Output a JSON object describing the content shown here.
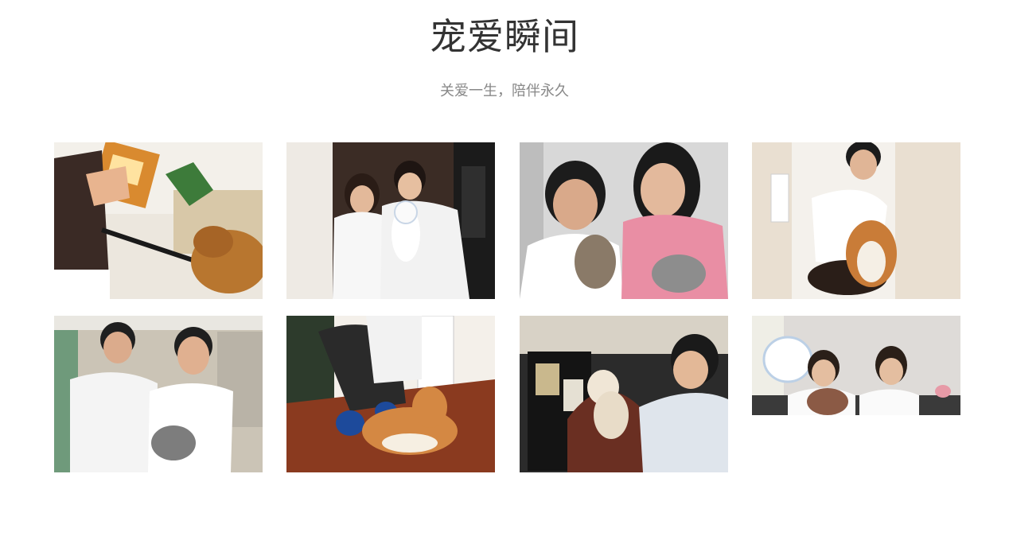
{
  "section": {
    "title": "宠爱瞬间",
    "subtitle": "关爱一生，陪伴永久"
  },
  "gallery": [
    {
      "id": "photo-1",
      "subject": "dog-with-treat-bag",
      "palette": [
        "#e9e4dd",
        "#b9772f",
        "#5a3a2a",
        "#3a7a3a",
        "#e3c28a"
      ]
    },
    {
      "id": "photo-2",
      "subject": "couple-with-white-cat",
      "palette": [
        "#3a2b24",
        "#f2f2f2",
        "#ffffff",
        "#d8c7b6",
        "#1c1c1c"
      ]
    },
    {
      "id": "photo-3",
      "subject": "two-girls-holding-cats",
      "palette": [
        "#d9d9d9",
        "#ffffff",
        "#e98fa4",
        "#8a7a6a",
        "#2a2a2a"
      ]
    },
    {
      "id": "photo-4",
      "subject": "vet-with-corgi",
      "palette": [
        "#ece1d2",
        "#ffffff",
        "#c7843f",
        "#3a2a1f",
        "#d8c9b5"
      ]
    },
    {
      "id": "photo-5",
      "subject": "two-men-with-grey-cat",
      "palette": [
        "#cfc9bd",
        "#f5f5f5",
        "#ffffff",
        "#7f7f7f",
        "#2d2d2d"
      ]
    },
    {
      "id": "photo-6",
      "subject": "shiba-on-wood-floor",
      "palette": [
        "#8a3b22",
        "#d48a42",
        "#f4f1ea",
        "#2a3a6a",
        "#1f1f1f"
      ]
    },
    {
      "id": "photo-7",
      "subject": "vet-with-chihuahua",
      "palette": [
        "#1e1e1e",
        "#e8e3da",
        "#6a2f22",
        "#dde3ea",
        "#c9b78f"
      ]
    },
    {
      "id": "photo-8",
      "subject": "two-vets-with-poodle",
      "palette": [
        "#e3e0e0",
        "#ffffff",
        "#8a5a44",
        "#bfd0e6",
        "#333333"
      ]
    }
  ]
}
